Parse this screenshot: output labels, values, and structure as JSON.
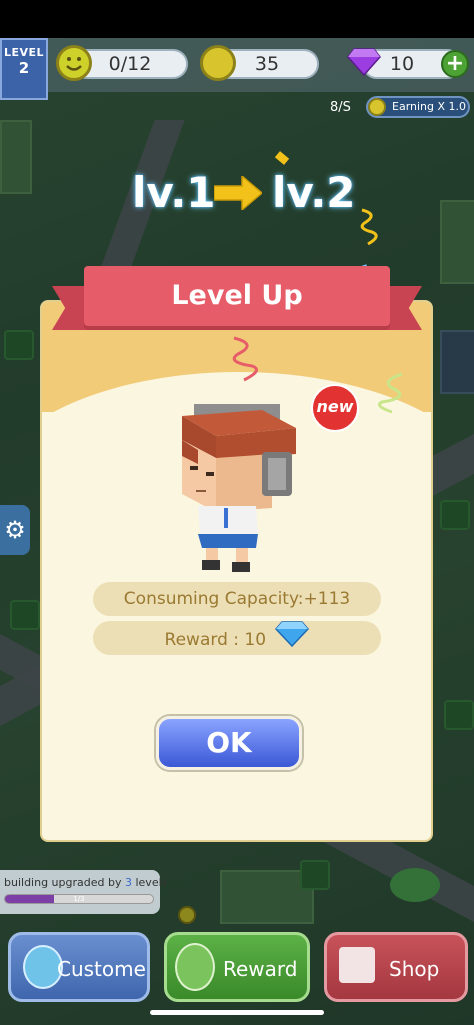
{
  "hud": {
    "level_label": "LEVEL",
    "level_value": "2",
    "population": "0/12",
    "coins": "35",
    "gems": "10",
    "plus_label": "+",
    "earning_rate": "8/S",
    "earning_multiplier": "Earning X 1.0"
  },
  "level_up": {
    "from_level": "lv.1",
    "to_level": "lv.2",
    "title": "Level Up",
    "new_badge": "new",
    "capacity_text": "Consuming Capacity:+113",
    "reward_text": "Reward : 10",
    "ok_label": "OK"
  },
  "upgrade_progress": {
    "prefix": "building upgraded by ",
    "count": "3",
    "suffix": " levels",
    "bar_label": "1/3",
    "fraction": 0.33
  },
  "bottom_nav": {
    "customer": "Custome",
    "reward": "Reward",
    "shop": "Shop"
  },
  "colors": {
    "ribbon": "#e65d69",
    "ok_button": "#3b58d6",
    "dialog_bg": "#fbf6df",
    "pill_text": "#9a7a32"
  }
}
